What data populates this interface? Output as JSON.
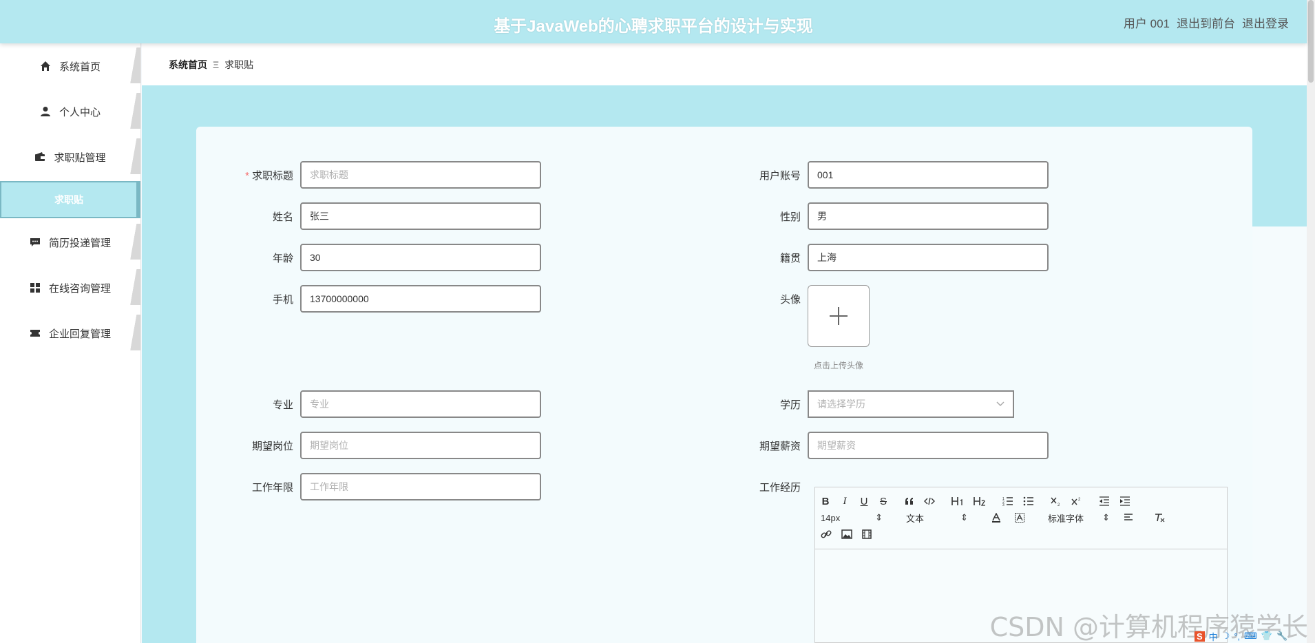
{
  "header": {
    "title": "基于JavaWeb的心聘求职平台的设计与实现",
    "user_label": "用户 001",
    "to_frontend": "退出到前台",
    "logout": "退出登录"
  },
  "sidebar": {
    "items": [
      {
        "label": "系统首页",
        "icon": "home-icon"
      },
      {
        "label": "个人中心",
        "icon": "user-icon"
      },
      {
        "label": "求职贴管理",
        "icon": "wallet-icon"
      },
      {
        "label": "求职贴",
        "icon": ""
      },
      {
        "label": "简历投递管理",
        "icon": "chat-icon"
      },
      {
        "label": "在线咨询管理",
        "icon": "grid-icon"
      },
      {
        "label": "企业回复管理",
        "icon": "ticket-icon"
      }
    ]
  },
  "breadcrumb": {
    "home": "系统首页",
    "separator": "Ξ",
    "current": "求职贴"
  },
  "form": {
    "title": {
      "label": "求职标题",
      "required": "*",
      "value": "",
      "placeholder": "求职标题"
    },
    "account": {
      "label": "用户账号",
      "value": "001"
    },
    "name": {
      "label": "姓名",
      "value": "张三"
    },
    "gender": {
      "label": "性别",
      "value": "男"
    },
    "age": {
      "label": "年龄",
      "value": "30"
    },
    "hometown": {
      "label": "籍贯",
      "value": "上海"
    },
    "phone": {
      "label": "手机",
      "value": "13700000000"
    },
    "avatar": {
      "label": "头像",
      "tip": "点击上传头像"
    },
    "major": {
      "label": "专业",
      "value": "",
      "placeholder": "专业"
    },
    "education": {
      "label": "学历",
      "placeholder": "请选择学历"
    },
    "position": {
      "label": "期望岗位",
      "value": "",
      "placeholder": "期望岗位"
    },
    "salary": {
      "label": "期望薪资",
      "value": "",
      "placeholder": "期望薪资"
    },
    "years": {
      "label": "工作年限",
      "value": "",
      "placeholder": "工作年限"
    },
    "experience": {
      "label": "工作经历"
    }
  },
  "editor": {
    "font_size": "14px",
    "block_type": "文本",
    "font_family": "标准字体",
    "buttons": [
      "B",
      "I",
      "U",
      "S"
    ]
  },
  "watermark": "CSDN @计算机程序猿学长",
  "ime": "中"
}
